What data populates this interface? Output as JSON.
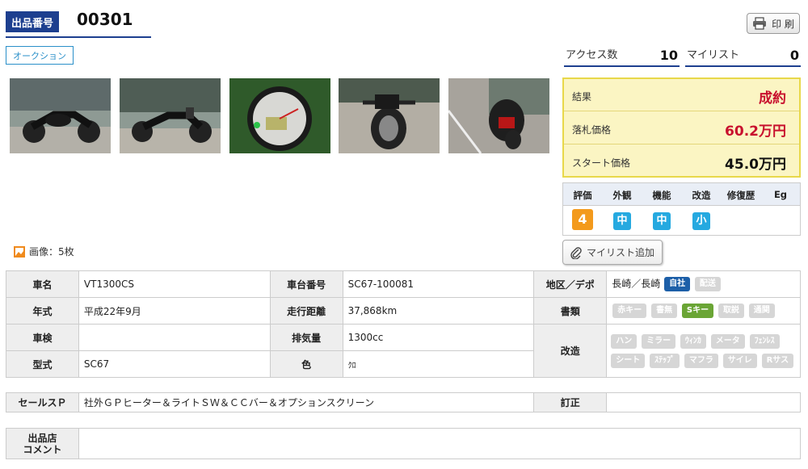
{
  "header": {
    "lot_label": "出品番号",
    "lot_number": "00301",
    "auction_label": "オークション",
    "print_label": "印 刷"
  },
  "counters": {
    "access_label": "アクセス数",
    "access_value": "10",
    "mylist_label": "マイリスト",
    "mylist_value": "0"
  },
  "result": {
    "result_label": "結果",
    "result_value": "成約",
    "bid_label": "落札価格",
    "bid_value": "60.2万円",
    "start_label": "スタート価格",
    "start_value": "45.0万円",
    "colors": {
      "result_red": "#c8102e"
    }
  },
  "grade": {
    "headers": [
      "評価",
      "外観",
      "機能",
      "改造",
      "修復歴",
      "Eg"
    ],
    "values": [
      "4",
      "中",
      "中",
      "小",
      "",
      ""
    ]
  },
  "mylist_add_label": "マイリスト追加",
  "image_count": "画像：5枚",
  "photos": [
    "bike-side-1",
    "bike-side-2",
    "speedometer",
    "bike-front",
    "bike-rear"
  ],
  "specs": {
    "name_label": "車名",
    "name_value": "VT1300CS",
    "frame_label": "車台番号",
    "frame_value": "SC67-100081",
    "region_label": "地区／デポ",
    "region_value": "長崎／長崎",
    "region_pills": [
      "自社",
      "配送"
    ],
    "year_label": "年式",
    "year_value": "平成22年9月",
    "mileage_label": "走行距離",
    "mileage_value": "37,868km",
    "docs_label": "書類",
    "docs_pills": [
      "赤キー",
      "書無",
      "Sキー",
      "取説",
      "通関"
    ],
    "inspection_label": "車検",
    "inspection_value": "",
    "displacement_label": "排気量",
    "displacement_value": "1300cc",
    "mod_label": "改造",
    "mod_pills_row1": [
      "ハン",
      "ミラー",
      "ｳｨﾝｶ",
      "メータ",
      "ﾌｪﾝﾚｽ"
    ],
    "mod_pills_row2": [
      "シート",
      "ｽﾃｯﾌﾟ",
      "マフラ",
      "サイレ",
      "Rサス"
    ],
    "model_label": "型式",
    "model_value": "SC67",
    "color_label": "色",
    "color_value": "ｸﾛ"
  },
  "sales": {
    "label": "セールスＰ",
    "value": "社外ＧＰヒーター＆ライトＳＷ＆ＣＣバー＆オプションスクリーン",
    "correction_label": "訂正",
    "correction_value": ""
  },
  "comment": {
    "label_line1": "出品店",
    "label_line2": "コメント",
    "value": ""
  }
}
